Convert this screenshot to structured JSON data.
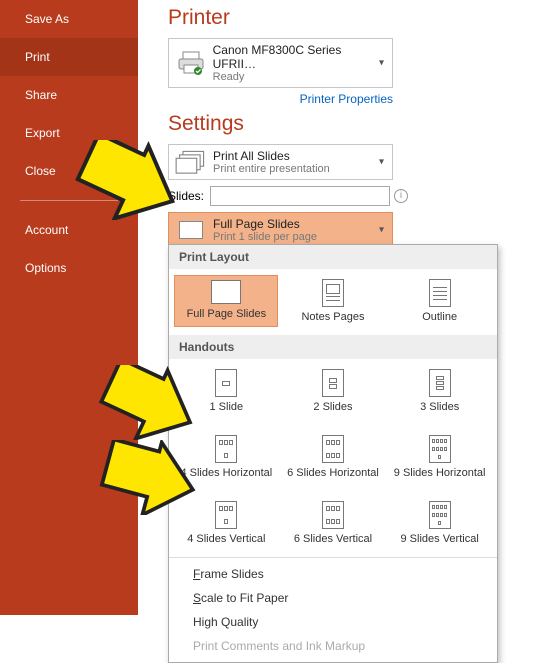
{
  "sidebar": {
    "items": [
      {
        "label": "Save As"
      },
      {
        "label": "Print"
      },
      {
        "label": "Share"
      },
      {
        "label": "Export"
      },
      {
        "label": "Close"
      },
      {
        "label": "Account"
      },
      {
        "label": "Options"
      }
    ]
  },
  "printer": {
    "heading": "Printer",
    "name": "Canon MF8300C Series UFRII…",
    "status": "Ready",
    "properties_link": "Printer Properties"
  },
  "settings": {
    "heading": "Settings",
    "print_all": {
      "title": "Print All Slides",
      "sub": "Print entire presentation"
    },
    "slides_label": "Slides:",
    "slides_value": "",
    "layout": {
      "title": "Full Page Slides",
      "sub": "Print 1 slide per page"
    }
  },
  "popup": {
    "section_layout": "Print Layout",
    "section_handouts": "Handouts",
    "layout_options": [
      {
        "label": "Full Page Slides"
      },
      {
        "label": "Notes Pages"
      },
      {
        "label": "Outline"
      }
    ],
    "handouts_row1": [
      {
        "label": "1 Slide"
      },
      {
        "label": "2 Slides"
      },
      {
        "label": "3 Slides"
      }
    ],
    "handouts_row2": [
      {
        "label": "4 Slides Horizontal"
      },
      {
        "label": "6 Slides Horizontal"
      },
      {
        "label": "9 Slides Horizontal"
      }
    ],
    "handouts_row3": [
      {
        "label": "4 Slides Vertical"
      },
      {
        "label": "6 Slides Vertical"
      },
      {
        "label": "9 Slides Vertical"
      }
    ],
    "menu": [
      {
        "label": "Frame Slides",
        "disabled": false
      },
      {
        "label": "Scale to Fit Paper",
        "disabled": false
      },
      {
        "label": "High Quality",
        "disabled": false
      },
      {
        "label": "Print Comments and Ink Markup",
        "disabled": true
      }
    ]
  }
}
